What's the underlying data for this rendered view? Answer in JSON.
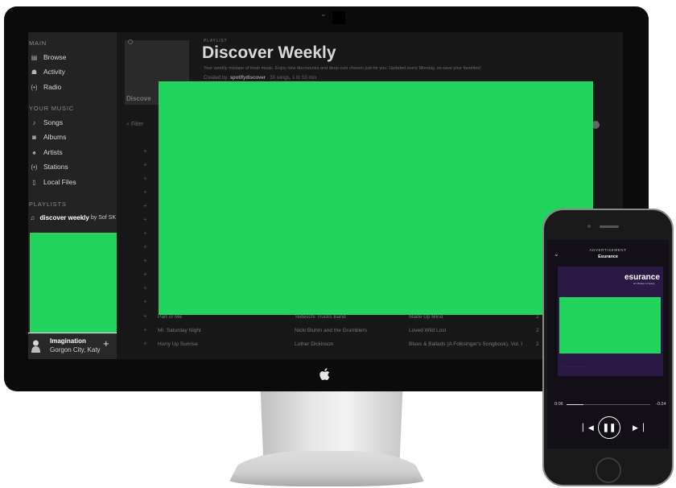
{
  "sidebar": {
    "main_heading": "MAIN",
    "main_items": [
      {
        "label": "Browse",
        "icon": "browse-icon",
        "glyph": "▤"
      },
      {
        "label": "Activity",
        "icon": "activity-icon",
        "glyph": "☗"
      },
      {
        "label": "Radio",
        "icon": "radio-icon",
        "glyph": "(•)"
      }
    ],
    "music_heading": "YOUR MUSIC",
    "music_items": [
      {
        "label": "Songs",
        "icon": "songs-icon",
        "glyph": "♪"
      },
      {
        "label": "Albums",
        "icon": "albums-icon",
        "glyph": "◙"
      },
      {
        "label": "Artists",
        "icon": "artists-icon",
        "glyph": "♠"
      },
      {
        "label": "Stations",
        "icon": "stations-icon",
        "glyph": "(•)"
      },
      {
        "label": "Local Files",
        "icon": "local-files-icon",
        "glyph": "▯"
      }
    ],
    "playlists_heading": "PLAYLISTS",
    "playlist_name": "discover weekly",
    "playlist_owner": "by Sof SK"
  },
  "now_playing": {
    "title": "Imagination",
    "artist": "Gorgon City, Katy",
    "add_glyph": "+"
  },
  "playlist": {
    "label": "PLAYLIST",
    "title": "Discover Weekly",
    "description": "Your weekly mixtape of fresh music. Enjoy new discoveries and deep cuts chosen just for you. Updated every Monday, so save your favorites!",
    "created_by_prefix": "Created by:",
    "owner": "spotifydiscover",
    "stats": "· 30 songs, 1 hr 53 min",
    "cover_text": "Discove",
    "filter_placeholder": "Filter"
  },
  "tracks": [
    {
      "name": "Part of Me",
      "artist": "Tedeschi Trucks Band",
      "album": "Made Up Mind",
      "date": "2"
    },
    {
      "name": "Mr. Saturday Night",
      "artist": "Nicki Bluhm and the Gramblers",
      "album": "Loved Wild Lost",
      "date": "2"
    },
    {
      "name": "Hurry Up Sunrise",
      "artist": "Luther Dickinson",
      "album": "Blues & Ballads (A Folksinger's Songbook), Vol. I",
      "date": "2"
    }
  ],
  "phone": {
    "ad_label": "ADVERTISEMENT",
    "brand": "Esurance",
    "logo_text": "esurance",
    "logo_sub": "an Allstate company",
    "time_elapsed": "0:06",
    "time_remaining": "-0:24",
    "progress": 0.2
  },
  "colors": {
    "accent": "#22d35e",
    "sidebar": "#232323",
    "background": "#181818"
  }
}
